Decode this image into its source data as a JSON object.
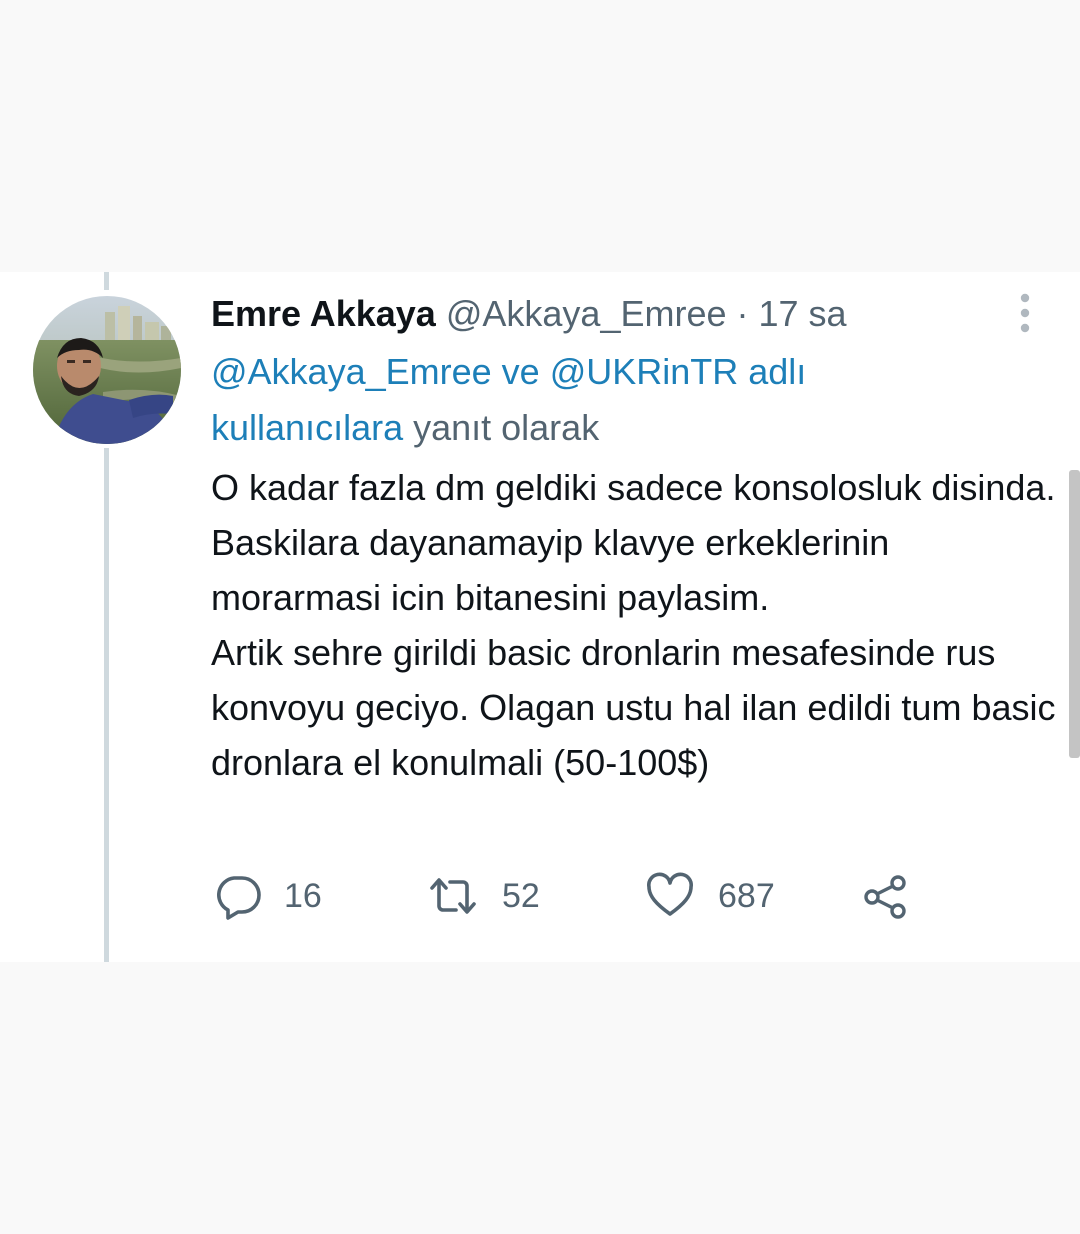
{
  "tweet": {
    "author_name": "Emre Akkaya",
    "author_handle": "@Akkaya_Emree",
    "separator": " · ",
    "time": "17 sa",
    "reply_to": {
      "mention_1": "@Akkaya_Emree",
      "connector": " ve ",
      "mention_2": "@UKRinTR",
      "suffix_link": " adlı kullanıcılara",
      "suffix_text": " yanıt olarak"
    },
    "paragraph_1": "O kadar fazla dm geldiki sadece konsolosluk disinda. Baskilara dayanamayip klavye erkeklerinin morarmasi icin bitanesini paylasim.",
    "paragraph_2": "Artik sehre girildi basic dronlarin mesafesinde rus konvoyu geciyo. Olagan ustu hal ilan edildi tum basic dronlara el konulmali (50-100$)"
  },
  "actions": {
    "replies": "16",
    "retweets": "52",
    "likes": "687"
  },
  "icons": {
    "avatar": "profile-photo",
    "more": "vertical-ellipsis-icon",
    "reply": "speech-bubble-icon",
    "retweet": "retweet-arrows-icon",
    "like": "heart-icon",
    "share": "share-nodes-icon"
  },
  "colors": {
    "link": "#1d7fb8",
    "text": "#0f1419",
    "secondary": "#536471",
    "thread_line": "#cfd9de"
  }
}
